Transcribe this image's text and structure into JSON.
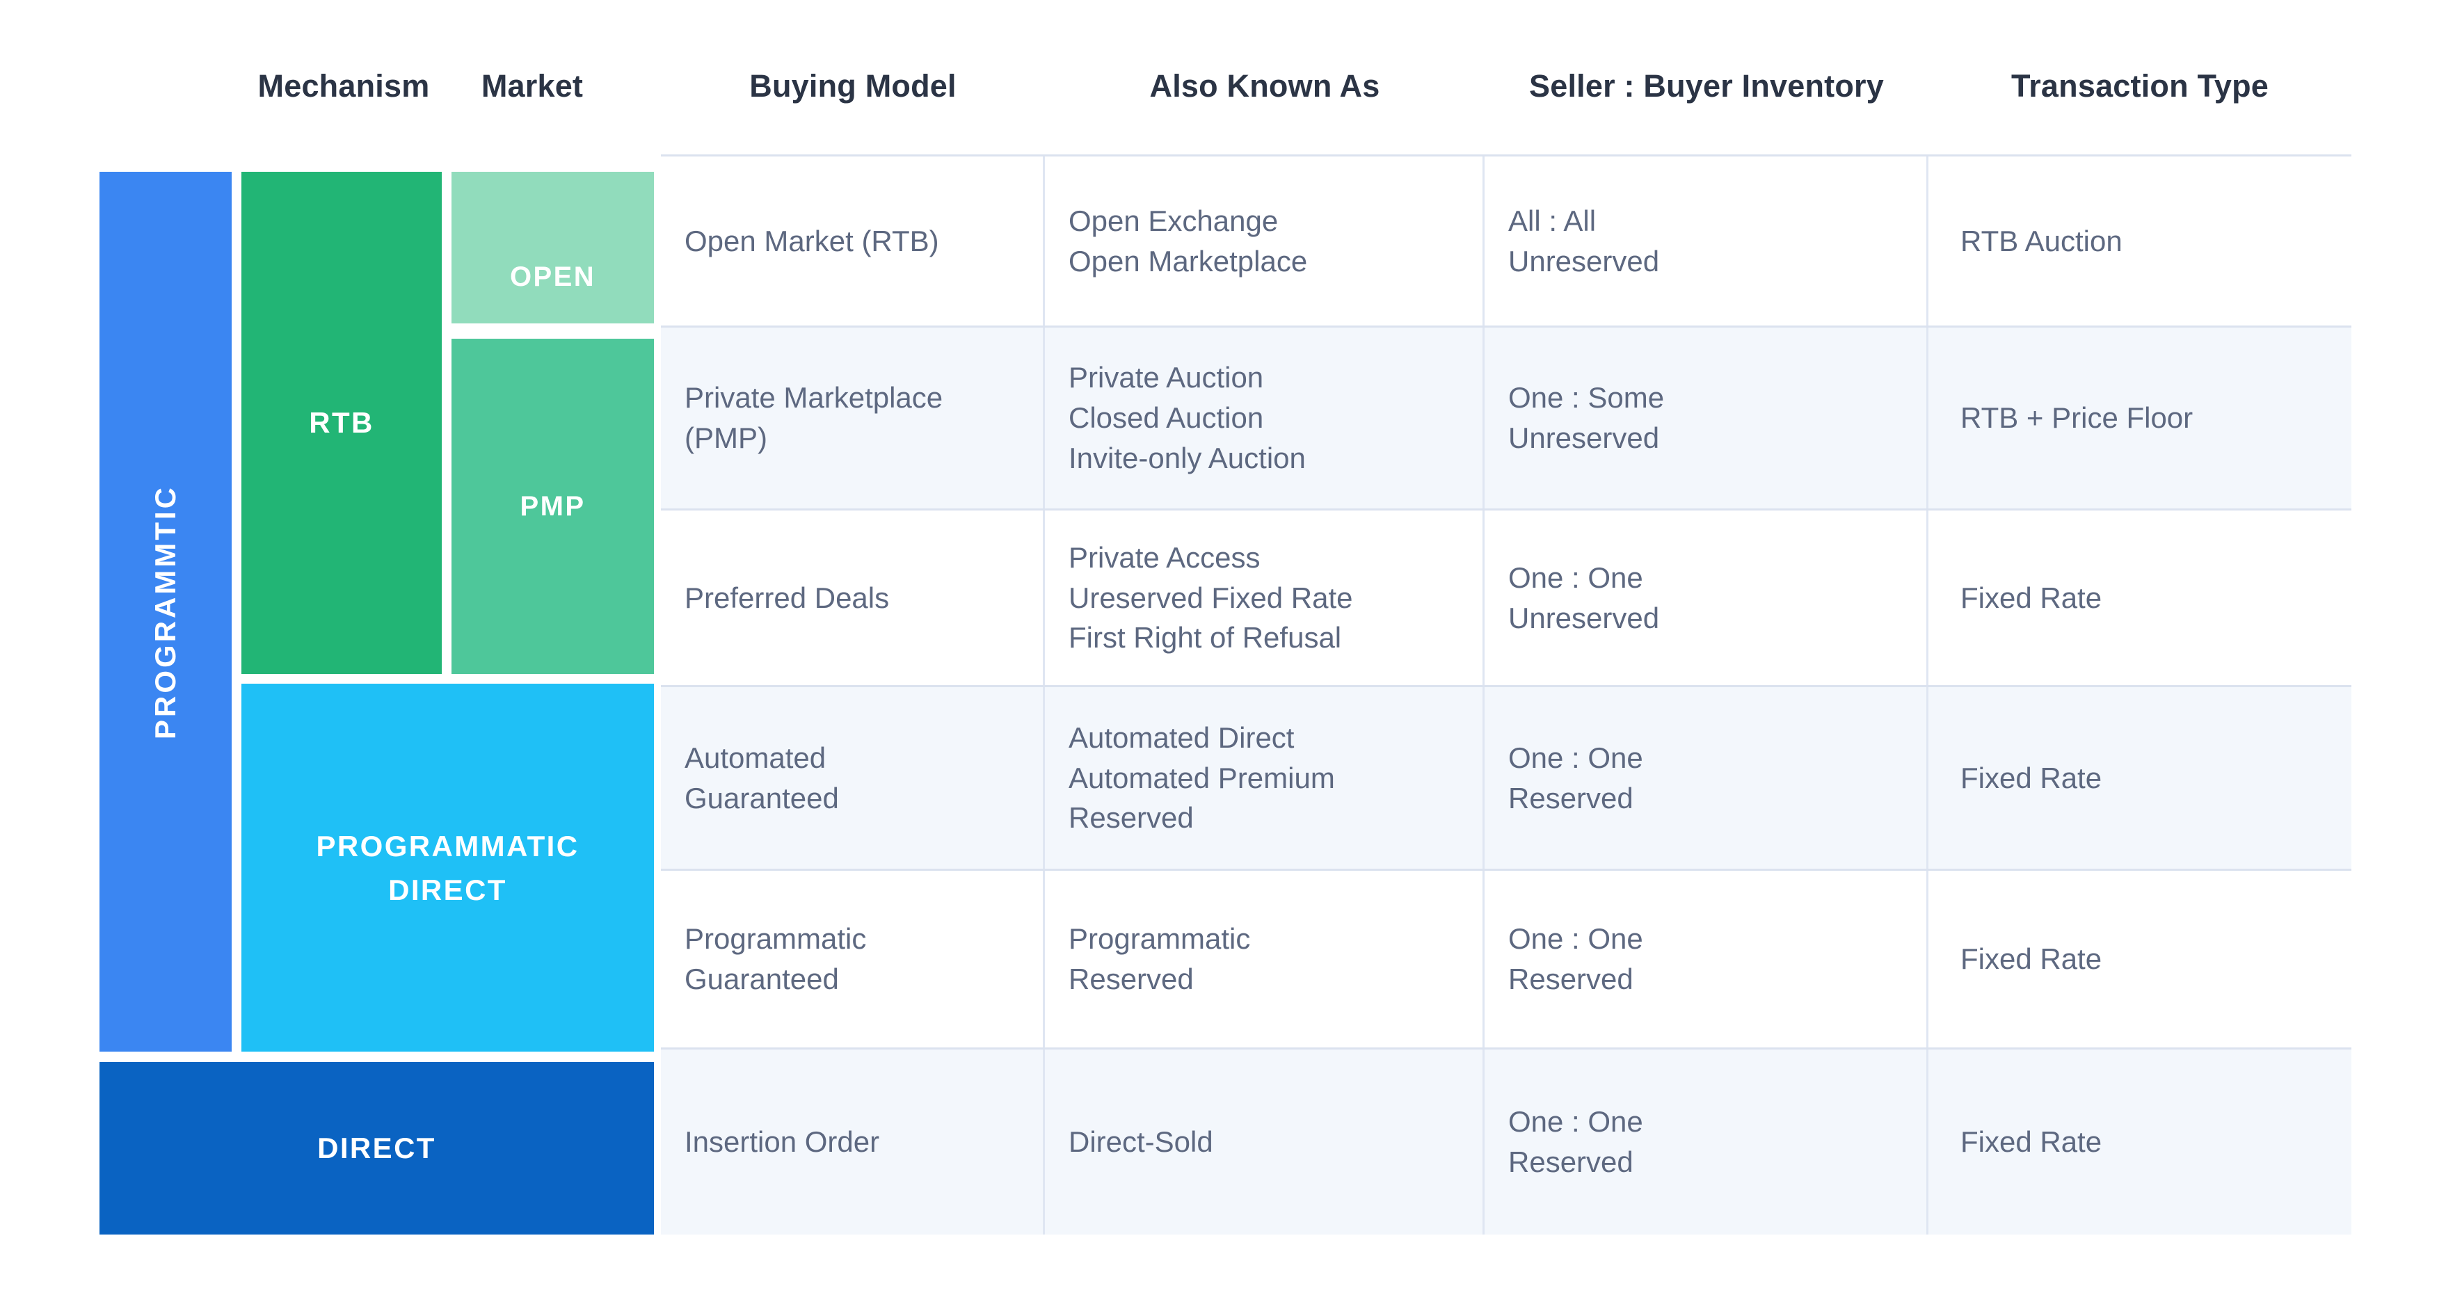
{
  "headers": {
    "mechanism": "Mechanism",
    "market": "Market",
    "buying_model": "Buying Model",
    "also_known_as": "Also Known As",
    "inventory": "Seller : Buyer Inventory",
    "transaction_type": "Transaction Type"
  },
  "blocks": {
    "programmatic": {
      "label": "PROGRAMMTIC",
      "color": "#3b86f2"
    },
    "rtb": {
      "label": "RTB",
      "color": "#22b575"
    },
    "open": {
      "label": "OPEN",
      "color": "#91dcbc"
    },
    "pmp": {
      "label": "PMP",
      "color": "#4ec79a"
    },
    "programmatic_direct": {
      "line1": "PROGRAMMATIC",
      "line2": "DIRECT",
      "color": "#1fc0f6"
    },
    "direct": {
      "label": "DIRECT",
      "color": "#0a63c2"
    }
  },
  "rows": [
    {
      "buying_model": [
        "Open Market (RTB)"
      ],
      "also_known_as": [
        "Open Exchange",
        "Open Marketplace"
      ],
      "inventory": [
        "All : All",
        "Unreserved"
      ],
      "transaction_type": [
        "RTB Auction"
      ]
    },
    {
      "buying_model": [
        "Private Marketplace",
        "(PMP)"
      ],
      "also_known_as": [
        "Private Auction",
        "Closed Auction",
        "Invite-only Auction"
      ],
      "inventory": [
        "One : Some",
        "Unreserved"
      ],
      "transaction_type": [
        "RTB + Price Floor"
      ]
    },
    {
      "buying_model": [
        "Preferred Deals"
      ],
      "also_known_as": [
        "Private Access",
        "Ureserved Fixed Rate",
        "First Right of Refusal"
      ],
      "inventory": [
        "One : One",
        "Unreserved"
      ],
      "transaction_type": [
        "Fixed Rate"
      ]
    },
    {
      "buying_model": [
        "Automated",
        "Guaranteed"
      ],
      "also_known_as": [
        "Automated Direct",
        "Automated Premium",
        "Reserved"
      ],
      "inventory": [
        "One : One",
        "Reserved"
      ],
      "transaction_type": [
        "Fixed Rate"
      ]
    },
    {
      "buying_model": [
        "Programmatic",
        "Guaranteed"
      ],
      "also_known_as": [
        "Programmatic",
        "Reserved"
      ],
      "inventory": [
        "One : One",
        "Reserved"
      ],
      "transaction_type": [
        "Fixed Rate"
      ]
    },
    {
      "buying_model": [
        "Insertion Order"
      ],
      "also_known_as": [
        "Direct-Sold"
      ],
      "inventory": [
        "One : One",
        "Reserved"
      ],
      "transaction_type": [
        "Fixed Rate"
      ]
    }
  ],
  "colors": {
    "header_text": "#2b3445",
    "body_text": "#5d6880",
    "row_stripe": "#f3f7fc",
    "grid_line": "#dbe2ef"
  }
}
